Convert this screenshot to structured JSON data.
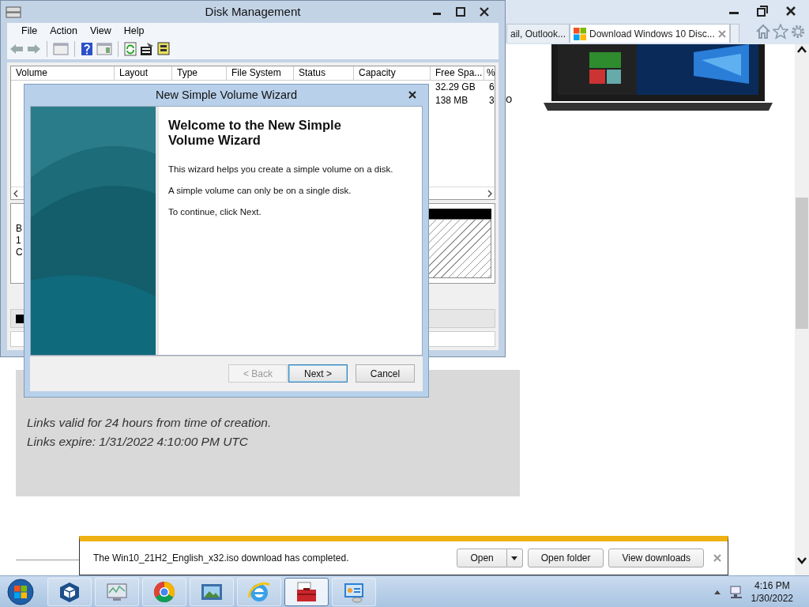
{
  "browser": {
    "tabs": [
      {
        "label": "ail, Outlook...",
        "selected": false
      },
      {
        "label": "Download Windows 10 Disc...",
        "selected": true
      }
    ],
    "page_text": "o",
    "info_box": {
      "lines": [
        "Links valid for 24 hours from time of creation.",
        "Links expire: 1/31/2022 4:10:00 PM UTC"
      ]
    },
    "download_bar": {
      "message": "The Win10_21H2_English_x32.iso download has completed.",
      "buttons": [
        "Open",
        "Open folder",
        "View downloads"
      ]
    }
  },
  "disk_management": {
    "title": "Disk Management",
    "menu": [
      "File",
      "Action",
      "View",
      "Help"
    ],
    "columns": [
      "Volume",
      "Layout",
      "Type",
      "File System",
      "Status",
      "Capacity",
      "Free Spa...",
      "%"
    ],
    "rows": [
      {
        "free_space": "32.29 GB",
        "percent": "6"
      },
      {
        "free_space": "138 MB",
        "percent": "3"
      }
    ],
    "disk_label_lines": [
      "B",
      "1",
      "C"
    ]
  },
  "wizard": {
    "title": "New Simple Volume Wizard",
    "heading": "Welcome to the New Simple Volume Wizard",
    "paragraphs": [
      "This wizard helps you create a simple volume on a disk.",
      "A simple volume can only be on a single disk.",
      "To continue, click Next."
    ],
    "buttons": [
      {
        "label": "< Back",
        "disabled": true,
        "default": false
      },
      {
        "label": "Next >",
        "disabled": false,
        "default": true
      },
      {
        "label": "Cancel",
        "disabled": false,
        "default": false
      }
    ]
  },
  "taskbar": {
    "apps": [
      {
        "selected": false
      },
      {
        "selected": false
      },
      {
        "selected": false
      },
      {
        "selected": false
      },
      {
        "selected": false
      },
      {
        "selected": true
      },
      {
        "selected": false
      }
    ],
    "time": "4:16 PM",
    "date": "1/30/2022"
  }
}
